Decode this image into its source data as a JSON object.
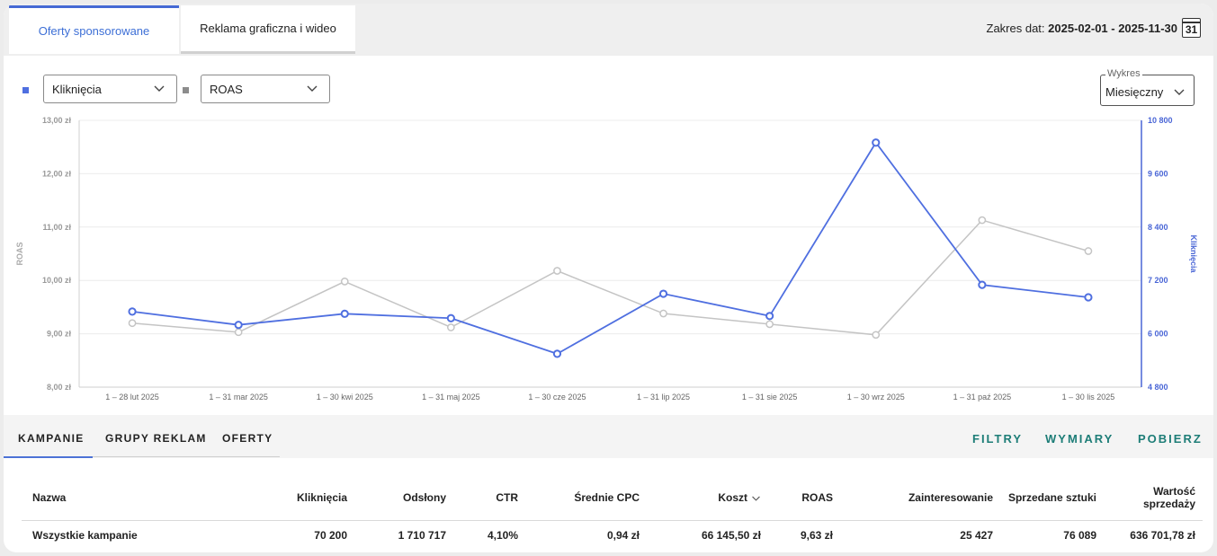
{
  "tabs": [
    {
      "label": "Oferty sponsorowane",
      "active": true
    },
    {
      "label": "Reklama graficzna i wideo",
      "active": false
    }
  ],
  "date_range": {
    "label": "Zakres dat:",
    "value": "2025-02-01 - 2025-11-30",
    "calendar_day": "31"
  },
  "metric_select_1": {
    "value": "Kliknięcia",
    "color": "#4f6fe0"
  },
  "metric_select_2": {
    "value": "ROAS",
    "color": "#8c8c8c"
  },
  "chart_type_select": {
    "label": "Wykres",
    "value": "Miesięczny"
  },
  "chart_data": {
    "type": "line",
    "categories": [
      "1 – 28 lut 2025",
      "1 – 31 mar 2025",
      "1 – 30 kwi 2025",
      "1 – 31 maj 2025",
      "1 – 30 cze 2025",
      "1 – 31 lip 2025",
      "1 – 31 sie 2025",
      "1 – 30 wrz 2025",
      "1 – 31 paź 2025",
      "1 – 30 lis 2025"
    ],
    "series": [
      {
        "name": "Kliknięcia",
        "axis": "right",
        "color": "#4f6fe0",
        "values": [
          6500,
          6200,
          6450,
          6350,
          5550,
          6900,
          6400,
          10300,
          7100,
          6820
        ]
      },
      {
        "name": "ROAS",
        "axis": "left",
        "color": "#c4c4c4",
        "values": [
          9.2,
          9.03,
          9.98,
          9.12,
          10.18,
          9.38,
          9.18,
          8.98,
          11.13,
          10.55
        ]
      }
    ],
    "y_left": {
      "label": "ROAS",
      "min": 8,
      "max": 13,
      "ticks": [
        "8,00 zł",
        "9,00 zł",
        "10,00 zł",
        "11,00 zł",
        "12,00 zł",
        "13,00 zł"
      ]
    },
    "y_right": {
      "label": "Kliknięcia",
      "min": 4800,
      "max": 10800,
      "ticks": [
        "4 800",
        "6 000",
        "7 200",
        "8 400",
        "9 600",
        "10 800"
      ]
    },
    "grid": true
  },
  "table_tabs": [
    "KAMPANIE",
    "GRUPY REKLAM",
    "OFERTY"
  ],
  "actions": [
    "FILTRY",
    "WYMIARY",
    "POBIERZ"
  ],
  "table": {
    "headers": [
      "Nazwa",
      "Kliknięcia",
      "Odsłony",
      "CTR",
      "Średnie CPC",
      "Koszt",
      "ROAS",
      "Zainteresowanie",
      "Sprzedane sztuki",
      "Wartość sprzedaży"
    ],
    "rows": [
      [
        "Wszystkie kampanie",
        "70 200",
        "1 710 717",
        "4,10%",
        "0,94 zł",
        "66 145,50 zł",
        "9,63 zł",
        "25 427",
        "76 089",
        "636 701,78 zł"
      ]
    ]
  }
}
